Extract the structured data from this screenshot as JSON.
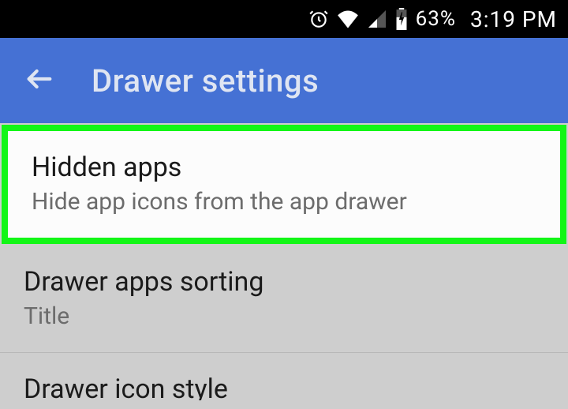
{
  "statusBar": {
    "battery": "63%",
    "time": "3:19 PM"
  },
  "appBar": {
    "title": "Drawer settings"
  },
  "settings": [
    {
      "title": "Hidden apps",
      "subtitle": "Hide app icons from the app drawer",
      "highlighted": true
    },
    {
      "title": "Drawer apps sorting",
      "subtitle": "Title",
      "highlighted": false
    },
    {
      "title": "Drawer icon style",
      "subtitle": "",
      "highlighted": false
    }
  ]
}
